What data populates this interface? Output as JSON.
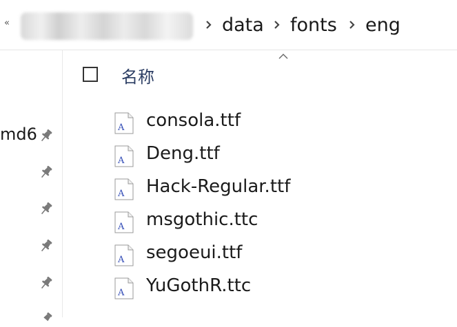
{
  "address_bar": {
    "collapse_glyph": "«",
    "segments": [
      "data",
      "fonts",
      "eng"
    ]
  },
  "nav": {
    "truncated_item": "md6"
  },
  "column_header": {
    "name_label": "名称"
  },
  "files": [
    {
      "name": "consola.ttf"
    },
    {
      "name": "Deng.ttf"
    },
    {
      "name": "Hack-Regular.ttf"
    },
    {
      "name": "msgothic.ttc"
    },
    {
      "name": "segoeui.ttf"
    },
    {
      "name": "YuGothR.ttc"
    }
  ],
  "icons": {
    "font_file": "font-file-icon",
    "pin": "pin-icon",
    "chevron": "chevron-right-icon",
    "sort": "sort-ascending-icon"
  },
  "colors": {
    "header_text": "#2b3d63",
    "font_icon_letter": "#2f49b5",
    "divider": "#e5e5e5"
  }
}
